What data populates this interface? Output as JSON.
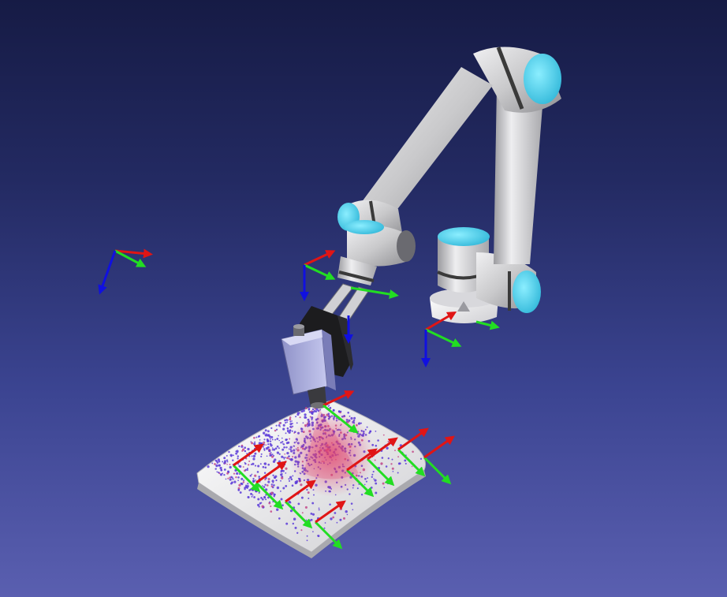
{
  "viewer": {
    "background_top": "#161b45",
    "background_bottom": "#5a5fb0",
    "axis_colors": {
      "x": "#e01515",
      "y": "#22dd22",
      "z": "#1010e0"
    }
  },
  "robot": {
    "link_color": "#c9c9cb",
    "joint_cap_color": "#4ad3ef",
    "ring_color": "#3a3a3a"
  },
  "workpiece": {
    "surface_color": "#e4e4e6",
    "point_cloud_color": "#5a3ad8",
    "spray_color": "#c0406a"
  },
  "frames": [
    "world-frame",
    "robot-base-frame",
    "tool-flange-frame",
    "tcp-frame",
    "camera-frame",
    "path-frame"
  ]
}
